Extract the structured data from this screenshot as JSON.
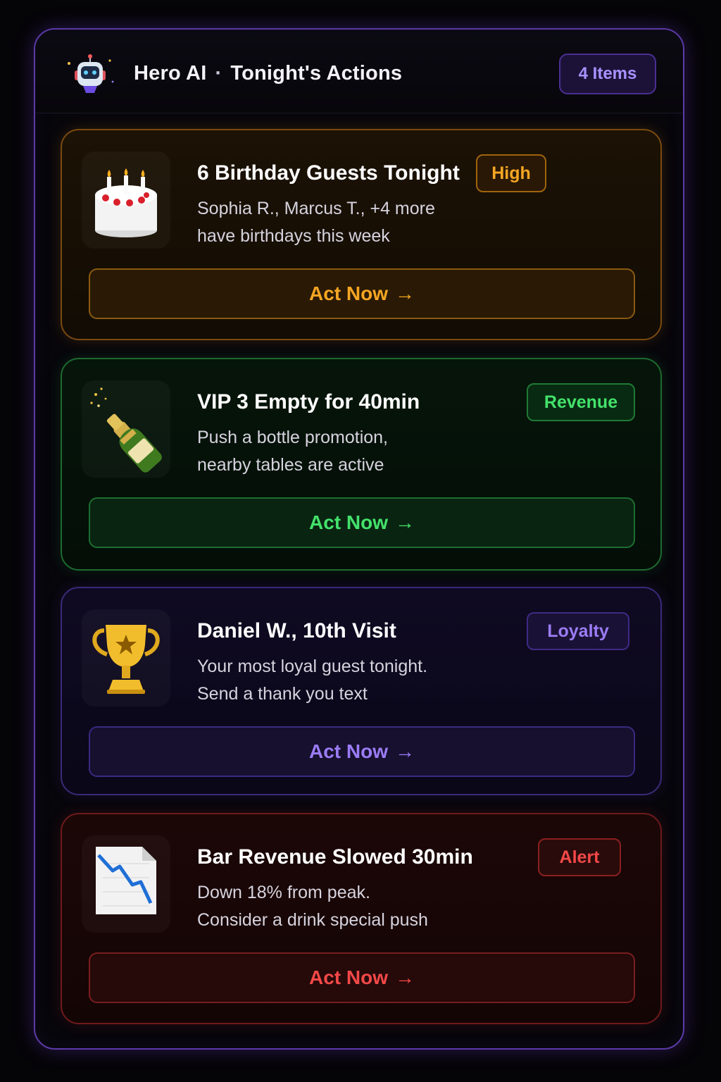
{
  "header": {
    "brand": "Hero AI",
    "separator": "·",
    "title": "Tonight's Actions",
    "count_badge": "4 Items",
    "logo_icon": "robot-icon"
  },
  "cards": [
    {
      "icon": "birthday-cake-icon",
      "title": "6 Birthday Guests Tonight",
      "tag": "High",
      "desc_line1": "Sophia R., Marcus T., +4 more",
      "desc_line2": "have birthdays this week",
      "action": "Act Now",
      "arrow": "→",
      "accent": "#f5a623"
    },
    {
      "icon": "champagne-bottle-icon",
      "title": "VIP 3 Empty for 40min",
      "tag": "Revenue",
      "desc_line1": "Push a bottle promotion,",
      "desc_line2": "nearby tables are active",
      "action": "Act Now",
      "arrow": "→",
      "accent": "#43e26b"
    },
    {
      "icon": "trophy-icon",
      "title": "Daniel W., 10th Visit",
      "tag": "Loyalty",
      "desc_line1": "Your most loyal guest tonight.",
      "desc_line2": "Send a thank you text",
      "action": "Act Now",
      "arrow": "→",
      "accent": "#9b7cf5"
    },
    {
      "icon": "chart-decreasing-icon",
      "title": "Bar Revenue Slowed 30min",
      "tag": "Alert",
      "desc_line1": "Down 18% from peak.",
      "desc_line2": "Consider a drink special push",
      "action": "Act Now",
      "arrow": "→",
      "accent": "#f44848"
    }
  ]
}
